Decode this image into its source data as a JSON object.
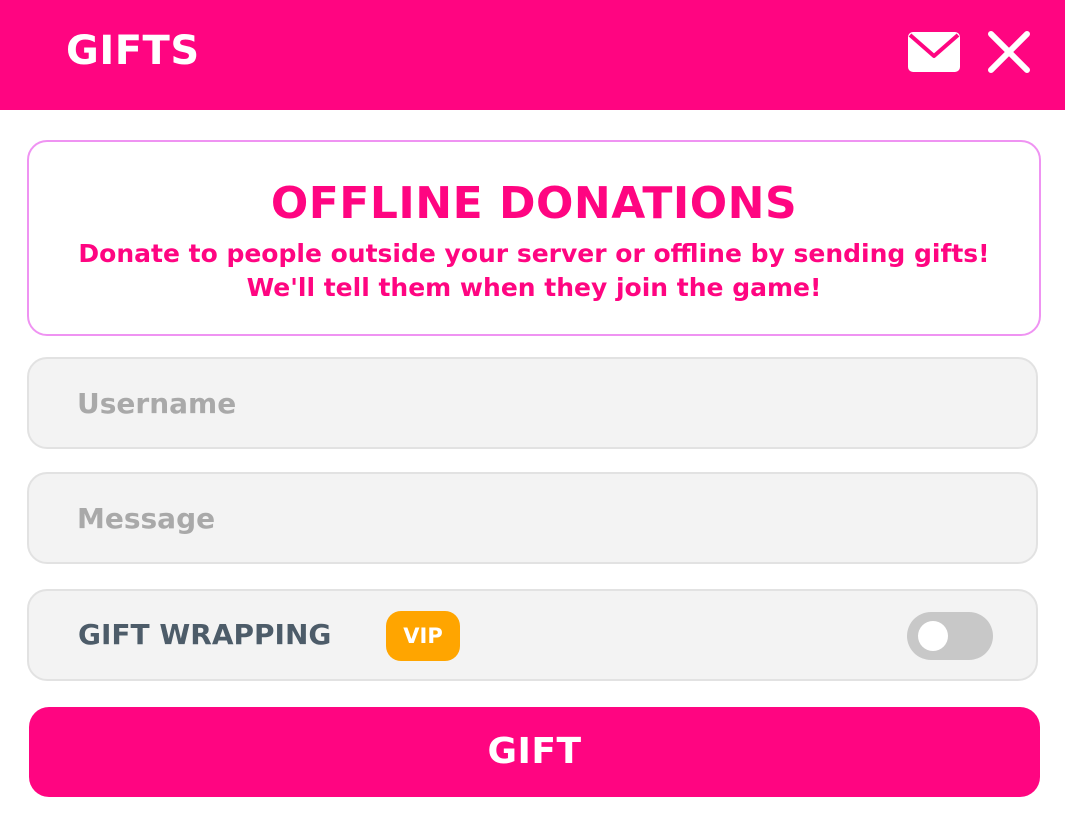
{
  "header": {
    "title": "GIFTS",
    "icons": {
      "mail": "mail-icon",
      "close": "close-icon"
    }
  },
  "info": {
    "title": "OFFLINE DONATIONS",
    "line1": "Donate to people outside your server or offline by sending gifts!",
    "line2": "We'll tell them when they join the game!"
  },
  "form": {
    "username": {
      "placeholder": "Username",
      "value": ""
    },
    "message": {
      "placeholder": "Message",
      "value": ""
    },
    "gift_wrapping": {
      "label": "GIFT WRAPPING",
      "badge": "VIP",
      "enabled": false
    },
    "submit_label": "GIFT"
  },
  "colors": {
    "accent": "#ff0581",
    "card_border": "#ef93f2",
    "field_bg": "#f3f3f3",
    "vip": "#ffa500",
    "toggle_off": "#c8c8c8",
    "label_text": "#4d5c69",
    "placeholder": "#a9a9a9"
  }
}
